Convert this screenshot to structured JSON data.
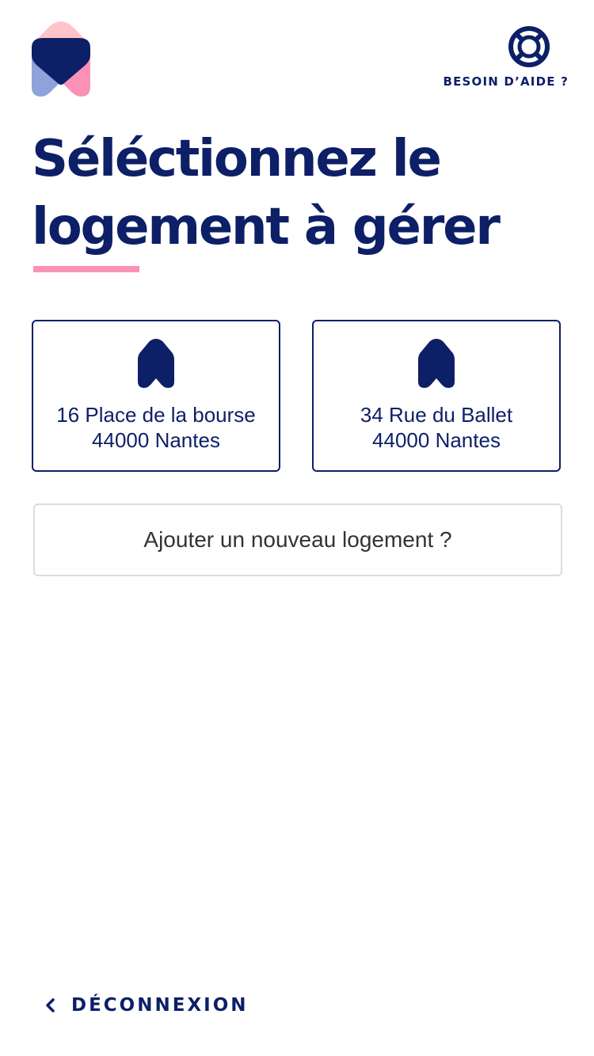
{
  "header": {
    "logo_icon": "house-heart-logo-icon",
    "help": {
      "icon": "lifebuoy-icon",
      "label": "BESOIN D’AIDE ?"
    }
  },
  "main": {
    "title_line_1": "Séléctionnez le",
    "title_line_2": "logement à gérer",
    "properties": [
      {
        "icon": "house-icon",
        "address_line_1": "16 Place de la bourse",
        "address_line_2": "44000 Nantes"
      },
      {
        "icon": "house-icon",
        "address_line_1": "34 Rue du Ballet",
        "address_line_2": "44000 Nantes"
      }
    ],
    "add_property_label": "Ajouter un nouveau logement ?"
  },
  "footer": {
    "back_icon": "chevron-left-icon",
    "logout_label": "DÉCONNEXION"
  },
  "colors": {
    "navy": "#0d1f66",
    "pink": "#fb92b6",
    "light_pink": "#ffc4c9",
    "light_blue": "#8fa2db",
    "border_grey": "#dcdcdc"
  }
}
